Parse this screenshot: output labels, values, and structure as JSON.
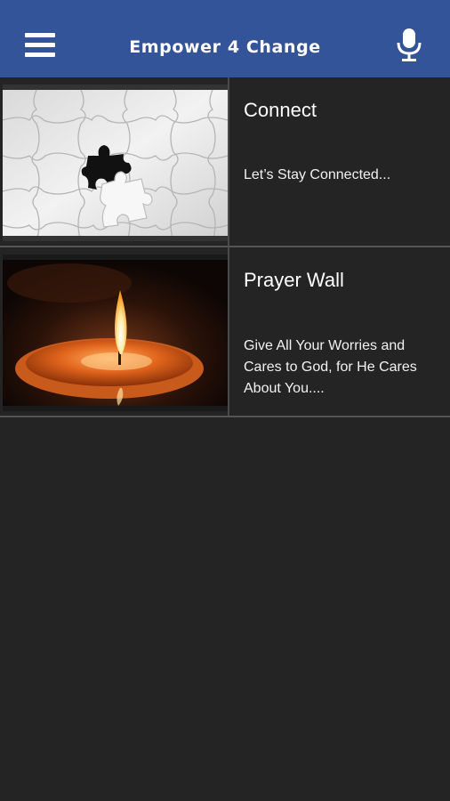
{
  "header": {
    "title": "Empower 4 Change",
    "background_color": "#34549a",
    "menu_icon": "hamburger-menu-icon",
    "voice_icon": "microphone-icon"
  },
  "items": [
    {
      "title": "Connect",
      "description": "Let’s Stay Connected...",
      "image": "puzzle-piece-image"
    },
    {
      "title": "Prayer Wall",
      "description": "Give All Your Worries and Cares to God, for He Cares About You....",
      "image": "candle-image"
    }
  ],
  "colors": {
    "background": "#242424",
    "divider": "#555555"
  }
}
